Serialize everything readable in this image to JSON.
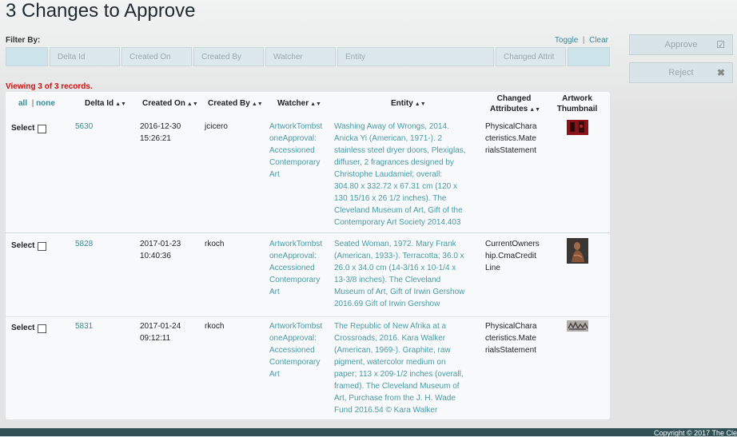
{
  "page": {
    "title": "3 Changes to Approve"
  },
  "filter": {
    "label": "Filter By:",
    "toggle": "Toggle",
    "separator": "|",
    "clear": "Clear",
    "fields": [
      "",
      "Delta Id",
      "Created On",
      "Created By",
      "Watcher",
      "Entity",
      "Changed Attrit",
      ""
    ]
  },
  "actions": {
    "approve": "Approve",
    "reject": "Reject"
  },
  "viewing": "Viewing 3 of 3 records.",
  "table": {
    "select_all": "all",
    "select_sep": "|",
    "select_none": "none",
    "headers": {
      "delta_id": "Delta Id",
      "created_on": "Created On",
      "created_by": "Created By",
      "watcher": "Watcher",
      "entity": "Entity",
      "changed_attrs_1": "Changed",
      "changed_attrs_2": "Attributes",
      "thumb_1": "Artwork",
      "thumb_2": "Thumbnail"
    },
    "rows": [
      {
        "select": "Select",
        "delta_id": "5630",
        "created_on": [
          "2016-12-30",
          "15:26:21"
        ],
        "created_by": "jcicero",
        "watcher": [
          "ArtworkTombst",
          "oneApproval:",
          "Accessioned",
          "Contemporary",
          "Art"
        ],
        "entity": [
          "Washing Away of Wrongs, 2014.",
          "Anicka Yi (American, 1971-). 2",
          "stainless steel dryer doors, Plexiglas,",
          "diffuser, 2 fragrances designed by",
          "Christophe Laudamiel; overall:",
          "304.80 x 332.72 x 67.31 cm (120 x",
          "130 15/16 x 26 1/2 inches). The",
          "Cleveland Museum of Art, Gift of the",
          "Contemporary Art Society 2014.403"
        ],
        "attrs": [
          "PhysicalChara",
          "cteristics.Mate",
          "rialsStatement"
        ]
      },
      {
        "select": "Select",
        "delta_id": "5828",
        "created_on": [
          "2017-01-23",
          "10:40:36"
        ],
        "created_by": "rkoch",
        "watcher": [
          "ArtworkTombst",
          "oneApproval:",
          "Accessioned",
          "Contemporary",
          "Art"
        ],
        "entity": [
          "Seated Woman, 1972. Mary Frank",
          "(American, 1933-). Terracotta; 36.0 x",
          "26.0 x 34.0 cm (14-3/16 x 10-1/4 x",
          "13-3/8 inches). The Cleveland",
          "Museum of Art, Gift of Irwin Gershow",
          "2016.69 Gift of Irwin Gershow"
        ],
        "attrs": [
          "CurrentOwners",
          "hip.CmaCredit",
          "Line"
        ]
      },
      {
        "select": "Select",
        "delta_id": "5831",
        "created_on": [
          "2017-01-24",
          "09:12:11"
        ],
        "created_by": "rkoch",
        "watcher": [
          "ArtworkTombst",
          "oneApproval:",
          "Accessioned",
          "Contemporary",
          "Art"
        ],
        "entity": [
          "The Republic of New Afrika at a",
          "Crossroads, 2016. Kara Walker",
          "(American, 1969-). Graphite, raw",
          "pigment, watercolor medium on",
          "paper; 113 x 209-1/2 inches (overall,",
          "framed). The Cleveland Museum of",
          "Art, Purchase from the J. H. Wade",
          "Fund 2016.54 © Kara Walker"
        ],
        "attrs": [
          "PhysicalChara",
          "cteristics.Mate",
          "rialsStatement"
        ]
      }
    ]
  },
  "footer": {
    "copyright": "Copyright © 2017 The Cle"
  },
  "colors": {
    "accent": "#3a8a96",
    "alert": "#cc1111",
    "footer": "#2f5156"
  },
  "icons": {
    "approve": "checkbox-edit-icon",
    "reject": "x-icon",
    "sort": "sort-arrows-icon"
  }
}
